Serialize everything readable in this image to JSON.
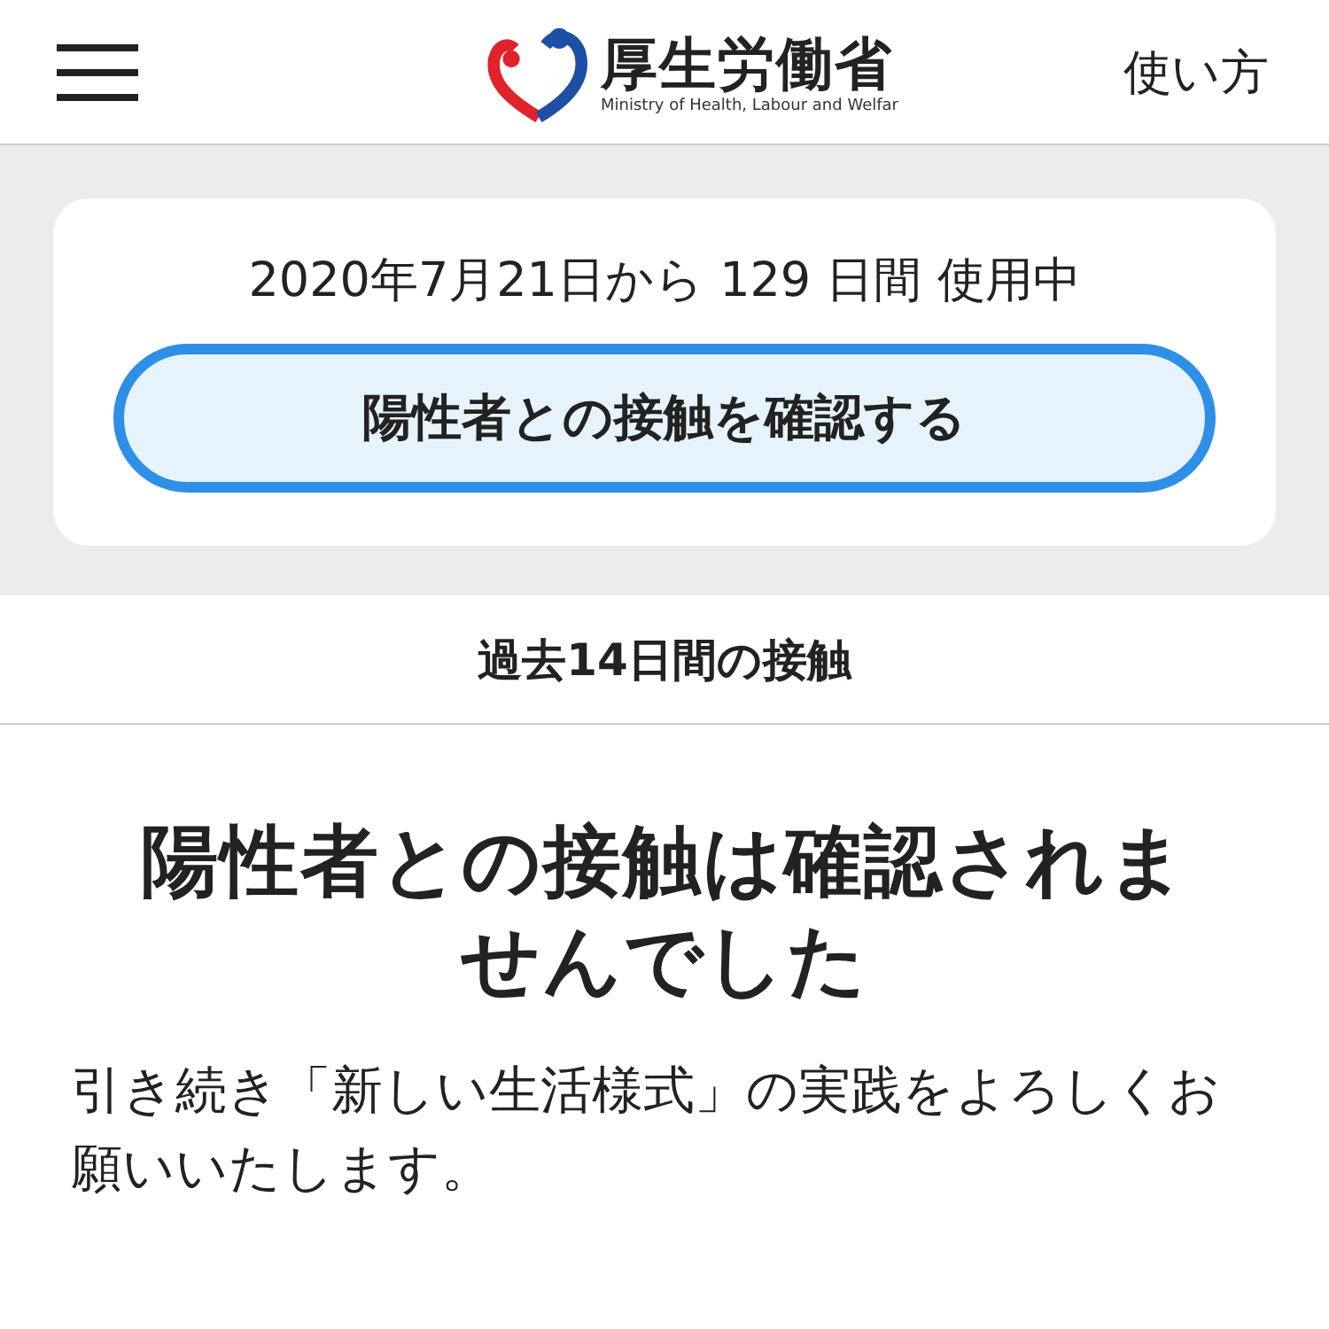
{
  "header": {
    "logo_title": "厚生労働省",
    "logo_subtitle": "Ministry of Health, Labour and Welfar",
    "help_link": "使い方"
  },
  "usage": {
    "text": "2020年7月21日から 129 日間 使用中",
    "button": "陽性者との接触を確認する"
  },
  "section_title": "過去14日間の接触",
  "result": {
    "heading": "陽性者との接触は確認されませんでした",
    "message": "引き続き「新しい生活様式」の実践をよろしくお願いいたします。"
  }
}
